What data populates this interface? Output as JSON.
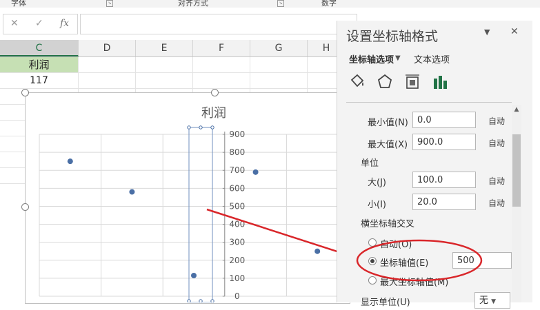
{
  "ribbon": {
    "groups": [
      "字体",
      "对齐方式",
      "数字"
    ]
  },
  "formula_bar": {
    "cancel_icon": "✕",
    "confirm_icon": "✓",
    "fx_label": "fx"
  },
  "columns": [
    "C",
    "D",
    "E",
    "F",
    "G",
    "H"
  ],
  "cells": {
    "c1": "利润",
    "c2": "117"
  },
  "chart": {
    "title": "利润"
  },
  "chart_data": {
    "type": "scatter",
    "title": "利润",
    "x": [
      1,
      2,
      3,
      4,
      5
    ],
    "y": [
      750,
      580,
      115,
      690,
      250
    ],
    "ylim": [
      0,
      900
    ],
    "y_ticks": [
      0,
      100,
      200,
      300,
      400,
      500,
      600,
      700,
      800,
      900
    ],
    "y_tick_labels": [
      "0",
      "100",
      "200",
      "300",
      "400",
      "500",
      "600",
      "700",
      "800",
      "900"
    ],
    "y_axis_crosses_at_x": 3.5,
    "grid": true,
    "marker_color": "#4a6fa5",
    "annotation_color": "#d9262a"
  },
  "pane": {
    "title": "设置坐标轴格式",
    "tab_axis": "坐标轴选项",
    "tab_text": "文本选项",
    "min_label": "最小值(N)",
    "min_value": "0.0",
    "min_auto": "自动",
    "max_label": "最大值(X)",
    "max_value": "900.0",
    "max_auto": "自动",
    "unit_heading": "单位",
    "major_label": "大(J)",
    "major_value": "100.0",
    "major_auto": "自动",
    "minor_label": "小(I)",
    "minor_value": "20.0",
    "minor_auto": "自动",
    "cross_heading": "横坐标轴交叉",
    "radio_auto": "自动(O)",
    "radio_axis_value": "坐标轴值(E)",
    "axis_value": "500",
    "radio_max": "最大坐标轴值(M)",
    "display_units": "显示单位(U)",
    "display_units_value": "无"
  }
}
